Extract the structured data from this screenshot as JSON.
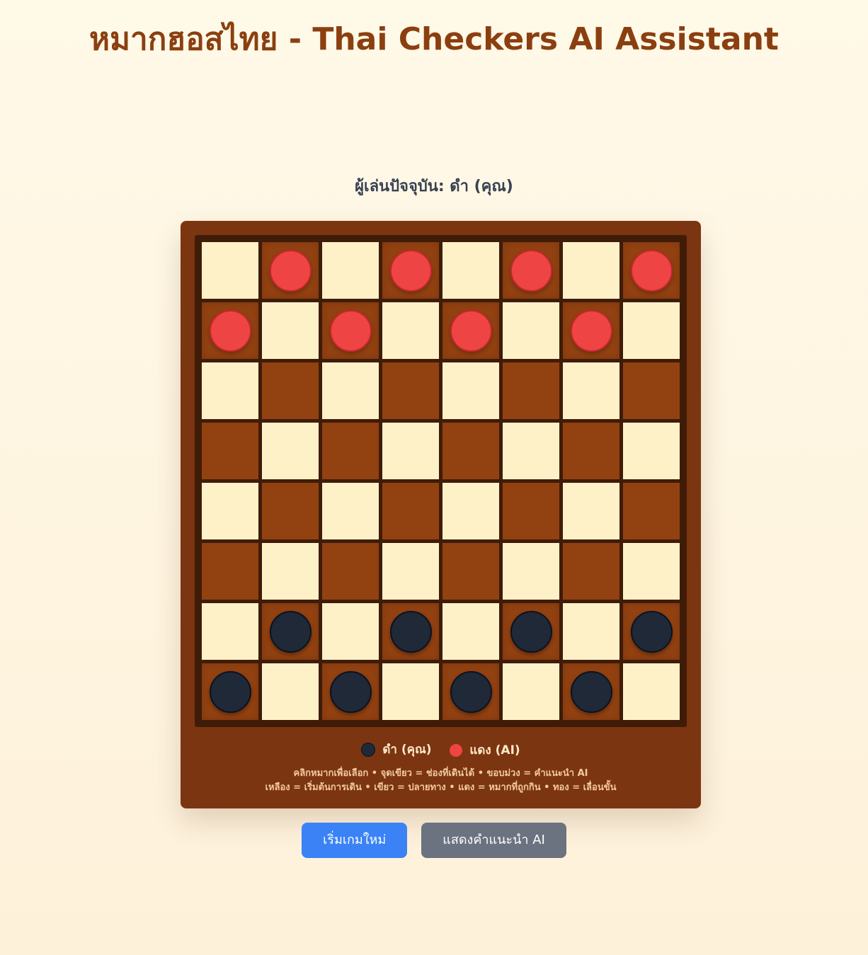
{
  "title": "หมากฮอสไทย - Thai Checkers AI Assistant",
  "status": {
    "current_player_text": "ผู้เล่นปัจจุบัน: ดำ (คุณ)"
  },
  "colors": {
    "title": "#8b3f10",
    "board_frame": "#7c3511",
    "light_square": "#fef1c8",
    "dark_square": "#924111",
    "red_piece": "#ef4444",
    "black_piece": "#1f2937",
    "primary_button": "#3b82f6",
    "secondary_button": "#6b7280"
  },
  "board": {
    "rows": [
      [
        "",
        "r",
        "",
        "r",
        "",
        "r",
        "",
        "r"
      ],
      [
        "r",
        "",
        "r",
        "",
        "r",
        "",
        "r",
        ""
      ],
      [
        "",
        "",
        "",
        "",
        "",
        "",
        "",
        ""
      ],
      [
        "",
        "",
        "",
        "",
        "",
        "",
        "",
        ""
      ],
      [
        "",
        "",
        "",
        "",
        "",
        "",
        "",
        ""
      ],
      [
        "",
        "",
        "",
        "",
        "",
        "",
        "",
        ""
      ],
      [
        "",
        "b",
        "",
        "b",
        "",
        "b",
        "",
        "b"
      ],
      [
        "b",
        "",
        "b",
        "",
        "b",
        "",
        "b",
        ""
      ]
    ]
  },
  "legend": {
    "black_label": "ดำ (คุณ)",
    "red_label": "แดง (AI)",
    "hint_line_1": "คลิกหมากเพื่อเลือก • จุดเขียว = ช่องที่เดินได้ • ขอบม่วง = คำแนะนำ AI",
    "hint_line_2": "เหลือง = เริ่มต้นการเดิน • เขียว = ปลายทาง • แดง = หมากที่ถูกกิน • ทอง = เลื่อนขั้น"
  },
  "buttons": {
    "new_game": "เริ่มเกมใหม่",
    "show_ai_hint": "แสดงคำแนะนำ AI"
  }
}
